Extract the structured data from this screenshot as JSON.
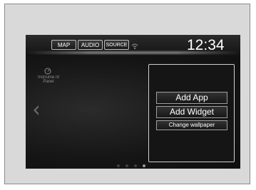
{
  "topbar": {
    "map_label": "MAP",
    "audio_label": "AUDIO",
    "source_label": "SOURCE",
    "clock": "12:34"
  },
  "home": {
    "instrument_panel_label": "Instrume nt Panel"
  },
  "panel": {
    "add_app_label": "Add App",
    "add_widget_label": "Add Widget",
    "change_wallpaper_label": "Change wallpaper"
  },
  "page_indicator": {
    "count": 4,
    "active_index": 4
  },
  "icons": [
    "wifi-icon",
    "gauge-icon",
    "arrow-left-icon"
  ],
  "colors": {
    "screen_bg": "#141414",
    "frame_bg": "#d9d9d9",
    "text": "#ffffff"
  }
}
